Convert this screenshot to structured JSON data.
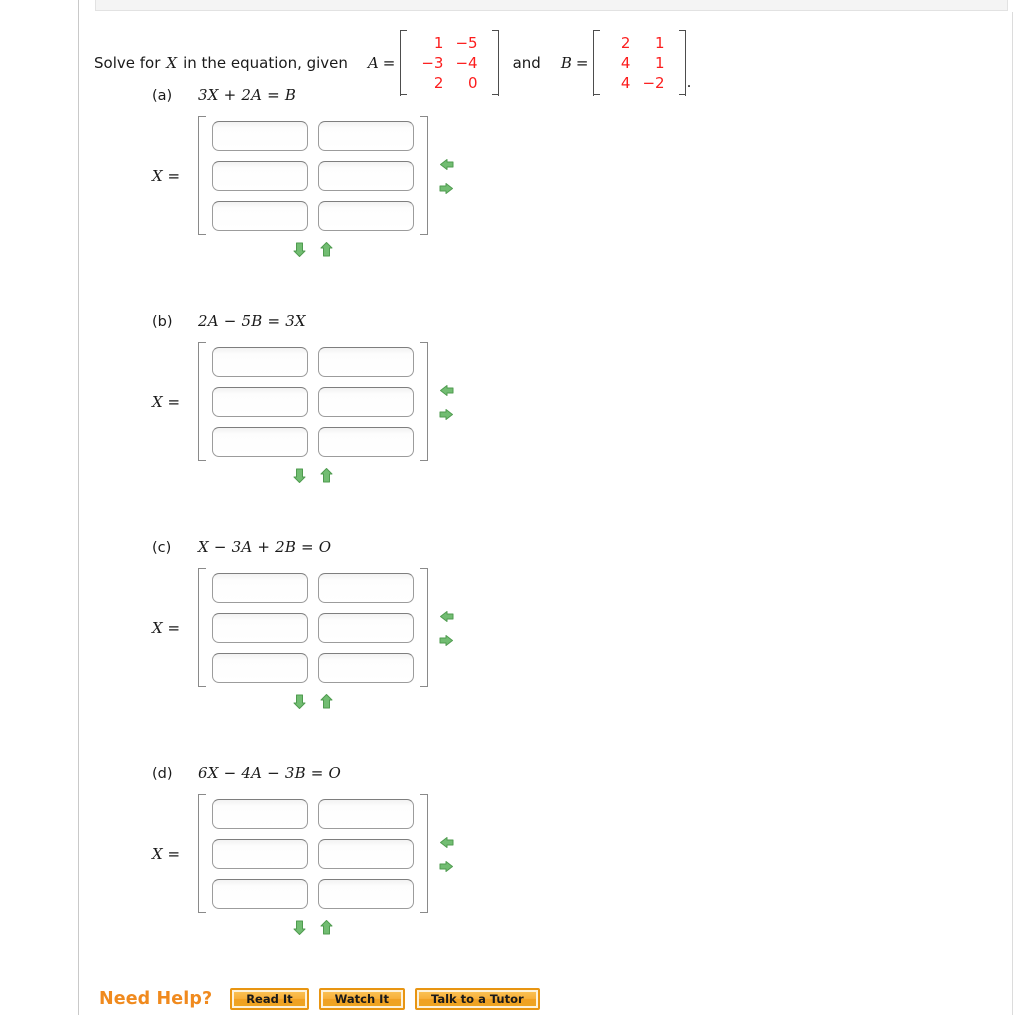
{
  "prompt": {
    "lead": "Solve for",
    "var": "X",
    "mid": "in the equation, given",
    "a_label": "A",
    "eq": "=",
    "and": "and",
    "b_label": "B",
    "period": "."
  },
  "matrix_a": {
    "name": "A",
    "rows": 3,
    "cols": 2,
    "values": [
      [
        "1",
        "−5"
      ],
      [
        "−3",
        "−4"
      ],
      [
        "2",
        "0"
      ]
    ],
    "color": "#fc1d1d"
  },
  "matrix_b": {
    "name": "B",
    "rows": 3,
    "cols": 2,
    "values": [
      [
        "2",
        "1"
      ],
      [
        "4",
        "1"
      ],
      [
        "4",
        "−2"
      ]
    ],
    "color": "#fc1d1d"
  },
  "answer_label": "X =",
  "answer_grid": {
    "rows": 3,
    "cols": 2,
    "placeholder": "",
    "values": [
      [
        "",
        ""
      ],
      [
        "",
        ""
      ],
      [
        "",
        ""
      ]
    ]
  },
  "controls": {
    "left_arrow": "left-arrow",
    "right_arrow": "right-arrow",
    "down_arrow": "down-arrow",
    "up_arrow": "up-arrow",
    "arrow_color": "#6fb96f"
  },
  "parts": [
    {
      "label": "(a)",
      "equation": "3X + 2A = B"
    },
    {
      "label": "(b)",
      "equation": "2A − 5B = 3X"
    },
    {
      "label": "(c)",
      "equation": "X − 3A + 2B = O"
    },
    {
      "label": "(d)",
      "equation": "6X − 4A − 3B = O"
    }
  ],
  "need_help": {
    "label": "Need Help?",
    "buttons": [
      "Read It",
      "Watch It",
      "Talk to a Tutor"
    ],
    "accent": "#f08a1e"
  }
}
